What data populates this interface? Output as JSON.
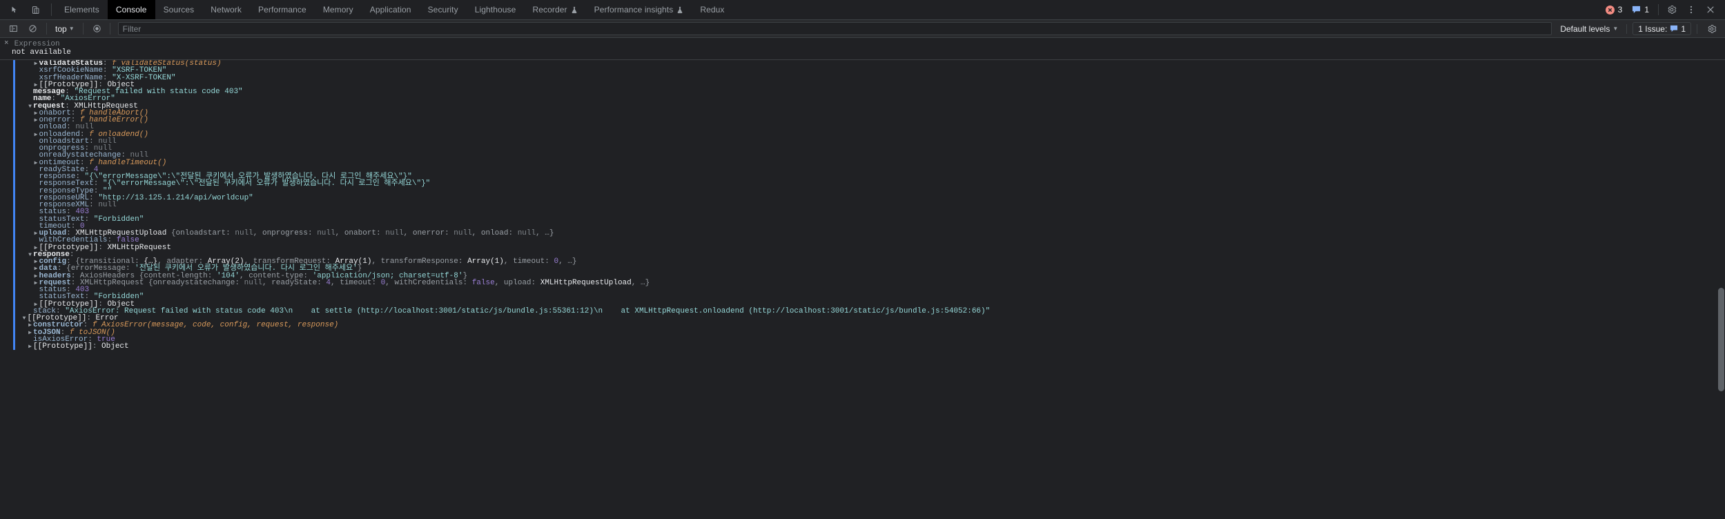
{
  "tabbar": {
    "tool_icons": [
      "inspect-element-icon",
      "device-toolbar-icon"
    ],
    "tabs": [
      {
        "label": "Elements",
        "selected": false,
        "flask": false
      },
      {
        "label": "Console",
        "selected": true,
        "flask": false
      },
      {
        "label": "Sources",
        "selected": false,
        "flask": false
      },
      {
        "label": "Network",
        "selected": false,
        "flask": false
      },
      {
        "label": "Performance",
        "selected": false,
        "flask": false
      },
      {
        "label": "Memory",
        "selected": false,
        "flask": false
      },
      {
        "label": "Application",
        "selected": false,
        "flask": false
      },
      {
        "label": "Security",
        "selected": false,
        "flask": false
      },
      {
        "label": "Lighthouse",
        "selected": false,
        "flask": false
      },
      {
        "label": "Recorder",
        "selected": false,
        "flask": true
      },
      {
        "label": "Performance insights",
        "selected": false,
        "flask": true
      },
      {
        "label": "Redux",
        "selected": false,
        "flask": false
      }
    ],
    "error_count": "3",
    "info_count": "1",
    "settings_label": "gear-icon",
    "more_label": "more-options-icon",
    "close_label": "close-icon"
  },
  "console_toolbar": {
    "sidebar_toggle": "console-sidebar-icon",
    "clear_label": "clear-console-icon",
    "context": "top",
    "eye_label": "live-expression-icon",
    "filter_placeholder": "Filter",
    "filter_value": "",
    "levels": "Default levels",
    "issues_text": "1 Issue:",
    "issues_count": "1",
    "settings_label": "console-settings-icon"
  },
  "expression": {
    "close": "×",
    "label": "Expression",
    "value": "not available"
  },
  "colors": {
    "accent_blue": "#4285f4",
    "error_red": "#f28b82",
    "info_blue": "#8ab4f8",
    "background": "#202124",
    "toolbar_bg": "#292a2d"
  },
  "console_lines": [
    {
      "indent": 3,
      "arrow": "right",
      "segments": [
        {
          "t": "validateStatus",
          "c": "k-own"
        },
        {
          "t": ": ",
          "c": "dim"
        },
        {
          "t": "f ",
          "c": "fnkw"
        },
        {
          "t": "validateStatus(status)",
          "c": "fn"
        }
      ]
    },
    {
      "indent": 3,
      "arrow": "none",
      "segments": [
        {
          "t": "xsrfCookieName",
          "c": "pname"
        },
        {
          "t": ": ",
          "c": "dim"
        },
        {
          "t": "\"XSRF-TOKEN\"",
          "c": "str"
        }
      ]
    },
    {
      "indent": 3,
      "arrow": "none",
      "segments": [
        {
          "t": "xsrfHeaderName",
          "c": "pname"
        },
        {
          "t": ": ",
          "c": "dim"
        },
        {
          "t": "\"X-XSRF-TOKEN\"",
          "c": "str"
        }
      ]
    },
    {
      "indent": 3,
      "arrow": "right",
      "segments": [
        {
          "t": "[[Prototype]]",
          "c": "proto"
        },
        {
          "t": ": ",
          "c": "dim"
        },
        {
          "t": "Object",
          "c": "obj"
        }
      ]
    },
    {
      "indent": 2,
      "arrow": "none",
      "segments": [
        {
          "t": "message",
          "c": "k-own"
        },
        {
          "t": ": ",
          "c": "dim"
        },
        {
          "t": "\"Request failed with status code 403\"",
          "c": "str"
        }
      ]
    },
    {
      "indent": 2,
      "arrow": "none",
      "segments": [
        {
          "t": "name",
          "c": "k-own"
        },
        {
          "t": ": ",
          "c": "dim"
        },
        {
          "t": "\"AxiosError\"",
          "c": "str"
        }
      ]
    },
    {
      "indent": 2,
      "arrow": "down",
      "segments": [
        {
          "t": "request",
          "c": "k-own"
        },
        {
          "t": ": ",
          "c": "dim"
        },
        {
          "t": "XMLHttpRequest",
          "c": "obj"
        }
      ]
    },
    {
      "indent": 3,
      "arrow": "right",
      "segments": [
        {
          "t": "onabort",
          "c": "pname"
        },
        {
          "t": ": ",
          "c": "dim"
        },
        {
          "t": "f ",
          "c": "fnkw"
        },
        {
          "t": "handleAbort()",
          "c": "fn"
        }
      ]
    },
    {
      "indent": 3,
      "arrow": "right",
      "segments": [
        {
          "t": "onerror",
          "c": "pname"
        },
        {
          "t": ": ",
          "c": "dim"
        },
        {
          "t": "f ",
          "c": "fnkw"
        },
        {
          "t": "handleError()",
          "c": "fn"
        }
      ]
    },
    {
      "indent": 3,
      "arrow": "none",
      "segments": [
        {
          "t": "onload",
          "c": "pname"
        },
        {
          "t": ": ",
          "c": "dim"
        },
        {
          "t": "null",
          "c": "nul"
        }
      ]
    },
    {
      "indent": 3,
      "arrow": "right",
      "segments": [
        {
          "t": "onloadend",
          "c": "pname"
        },
        {
          "t": ": ",
          "c": "dim"
        },
        {
          "t": "f ",
          "c": "fnkw"
        },
        {
          "t": "onloadend()",
          "c": "fn"
        }
      ]
    },
    {
      "indent": 3,
      "arrow": "none",
      "segments": [
        {
          "t": "onloadstart",
          "c": "pname"
        },
        {
          "t": ": ",
          "c": "dim"
        },
        {
          "t": "null",
          "c": "nul"
        }
      ]
    },
    {
      "indent": 3,
      "arrow": "none",
      "segments": [
        {
          "t": "onprogress",
          "c": "pname"
        },
        {
          "t": ": ",
          "c": "dim"
        },
        {
          "t": "null",
          "c": "nul"
        }
      ]
    },
    {
      "indent": 3,
      "arrow": "none",
      "segments": [
        {
          "t": "onreadystatechange",
          "c": "pname"
        },
        {
          "t": ": ",
          "c": "dim"
        },
        {
          "t": "null",
          "c": "nul"
        }
      ]
    },
    {
      "indent": 3,
      "arrow": "right",
      "segments": [
        {
          "t": "ontimeout",
          "c": "pname"
        },
        {
          "t": ": ",
          "c": "dim"
        },
        {
          "t": "f ",
          "c": "fnkw"
        },
        {
          "t": "handleTimeout()",
          "c": "fn"
        }
      ]
    },
    {
      "indent": 3,
      "arrow": "none",
      "segments": [
        {
          "t": "readyState",
          "c": "pname"
        },
        {
          "t": ": ",
          "c": "dim"
        },
        {
          "t": "4",
          "c": "num"
        }
      ]
    },
    {
      "indent": 3,
      "arrow": "none",
      "segments": [
        {
          "t": "response",
          "c": "pname"
        },
        {
          "t": ": ",
          "c": "dim"
        },
        {
          "t": "\"{\\\"errorMessage\\\":\\\"전달된 쿠키에서 오류가 발생하였습니다. 다시 로그인 해주세요\\\"}\"",
          "c": "str"
        }
      ]
    },
    {
      "indent": 3,
      "arrow": "none",
      "segments": [
        {
          "t": "responseText",
          "c": "pname"
        },
        {
          "t": ": ",
          "c": "dim"
        },
        {
          "t": "\"{\\\"errorMessage\\\":\\\"전달된 쿠키에서 오류가 발생하였습니다. 다시 로그인 해주세요\\\"}\"",
          "c": "str"
        }
      ]
    },
    {
      "indent": 3,
      "arrow": "none",
      "segments": [
        {
          "t": "responseType",
          "c": "pname"
        },
        {
          "t": ": ",
          "c": "dim"
        },
        {
          "t": "\"\"",
          "c": "str"
        }
      ]
    },
    {
      "indent": 3,
      "arrow": "none",
      "segments": [
        {
          "t": "responseURL",
          "c": "pname"
        },
        {
          "t": ": ",
          "c": "dim"
        },
        {
          "t": "\"http://13.125.1.214/api/worldcup\"",
          "c": "str"
        }
      ]
    },
    {
      "indent": 3,
      "arrow": "none",
      "segments": [
        {
          "t": "responseXML",
          "c": "pname"
        },
        {
          "t": ": ",
          "c": "dim"
        },
        {
          "t": "null",
          "c": "nul"
        }
      ]
    },
    {
      "indent": 3,
      "arrow": "none",
      "segments": [
        {
          "t": "status",
          "c": "pname"
        },
        {
          "t": ": ",
          "c": "dim"
        },
        {
          "t": "403",
          "c": "num"
        }
      ]
    },
    {
      "indent": 3,
      "arrow": "none",
      "segments": [
        {
          "t": "statusText",
          "c": "pname"
        },
        {
          "t": ": ",
          "c": "dim"
        },
        {
          "t": "\"Forbidden\"",
          "c": "str"
        }
      ]
    },
    {
      "indent": 3,
      "arrow": "none",
      "segments": [
        {
          "t": "timeout",
          "c": "pname"
        },
        {
          "t": ": ",
          "c": "dim"
        },
        {
          "t": "0",
          "c": "num"
        }
      ]
    },
    {
      "indent": 3,
      "arrow": "right",
      "segments": [
        {
          "t": "upload",
          "c": "pname-b"
        },
        {
          "t": ": ",
          "c": "dim"
        },
        {
          "t": "XMLHttpRequestUpload ",
          "c": "obj"
        },
        {
          "t": "{",
          "c": "dim"
        },
        {
          "t": "onloadstart",
          "c": "dim"
        },
        {
          "t": ": ",
          "c": "dim"
        },
        {
          "t": "null",
          "c": "nul"
        },
        {
          "t": ", ",
          "c": "dim"
        },
        {
          "t": "onprogress",
          "c": "dim"
        },
        {
          "t": ": ",
          "c": "dim"
        },
        {
          "t": "null",
          "c": "nul"
        },
        {
          "t": ", ",
          "c": "dim"
        },
        {
          "t": "onabort",
          "c": "dim"
        },
        {
          "t": ": ",
          "c": "dim"
        },
        {
          "t": "null",
          "c": "nul"
        },
        {
          "t": ", ",
          "c": "dim"
        },
        {
          "t": "onerror",
          "c": "dim"
        },
        {
          "t": ": ",
          "c": "dim"
        },
        {
          "t": "null",
          "c": "nul"
        },
        {
          "t": ", ",
          "c": "dim"
        },
        {
          "t": "onload",
          "c": "dim"
        },
        {
          "t": ": ",
          "c": "dim"
        },
        {
          "t": "null",
          "c": "nul"
        },
        {
          "t": ", …}",
          "c": "dim"
        }
      ]
    },
    {
      "indent": 3,
      "arrow": "none",
      "segments": [
        {
          "t": "withCredentials",
          "c": "pname"
        },
        {
          "t": ": ",
          "c": "dim"
        },
        {
          "t": "false",
          "c": "bool"
        }
      ]
    },
    {
      "indent": 3,
      "arrow": "right",
      "segments": [
        {
          "t": "[[Prototype]]",
          "c": "proto"
        },
        {
          "t": ": ",
          "c": "dim"
        },
        {
          "t": "XMLHttpRequest",
          "c": "obj"
        }
      ]
    },
    {
      "indent": 2,
      "arrow": "down",
      "segments": [
        {
          "t": "response",
          "c": "k-own"
        },
        {
          "t": ":",
          "c": "dim"
        }
      ]
    },
    {
      "indent": 3,
      "arrow": "right",
      "segments": [
        {
          "t": "config",
          "c": "pname-b"
        },
        {
          "t": ": ",
          "c": "dim"
        },
        {
          "t": "{",
          "c": "dim"
        },
        {
          "t": "transitional",
          "c": "dim"
        },
        {
          "t": ": ",
          "c": "dim"
        },
        {
          "t": "{…}",
          "c": "obj"
        },
        {
          "t": ", ",
          "c": "dim"
        },
        {
          "t": "adapter",
          "c": "dim"
        },
        {
          "t": ": ",
          "c": "dim"
        },
        {
          "t": "Array(2)",
          "c": "obj"
        },
        {
          "t": ", ",
          "c": "dim"
        },
        {
          "t": "transformRequest",
          "c": "dim"
        },
        {
          "t": ": ",
          "c": "dim"
        },
        {
          "t": "Array(1)",
          "c": "obj"
        },
        {
          "t": ", ",
          "c": "dim"
        },
        {
          "t": "transformResponse",
          "c": "dim"
        },
        {
          "t": ": ",
          "c": "dim"
        },
        {
          "t": "Array(1)",
          "c": "obj"
        },
        {
          "t": ", ",
          "c": "dim"
        },
        {
          "t": "timeout",
          "c": "dim"
        },
        {
          "t": ": ",
          "c": "dim"
        },
        {
          "t": "0",
          "c": "num"
        },
        {
          "t": ", …}",
          "c": "dim"
        }
      ]
    },
    {
      "indent": 3,
      "arrow": "right",
      "segments": [
        {
          "t": "data",
          "c": "pname-b"
        },
        {
          "t": ": ",
          "c": "dim"
        },
        {
          "t": "{",
          "c": "dim"
        },
        {
          "t": "errorMessage",
          "c": "dim"
        },
        {
          "t": ": ",
          "c": "dim"
        },
        {
          "t": "'전달된 쿠키에서 오류가 발생하였습니다. 다시 로그인 해주세요'",
          "c": "str"
        },
        {
          "t": "}",
          "c": "dim"
        }
      ]
    },
    {
      "indent": 3,
      "arrow": "right",
      "segments": [
        {
          "t": "headers",
          "c": "pname-b"
        },
        {
          "t": ": ",
          "c": "dim"
        },
        {
          "t": "AxiosHeaders ",
          "c": "dim"
        },
        {
          "t": "{",
          "c": "dim"
        },
        {
          "t": "content-length",
          "c": "dim"
        },
        {
          "t": ": ",
          "c": "dim"
        },
        {
          "t": "'104'",
          "c": "str"
        },
        {
          "t": ", ",
          "c": "dim"
        },
        {
          "t": "content-type",
          "c": "dim"
        },
        {
          "t": ": ",
          "c": "dim"
        },
        {
          "t": "'application/json; charset=utf-8'",
          "c": "str"
        },
        {
          "t": "}",
          "c": "dim"
        }
      ]
    },
    {
      "indent": 3,
      "arrow": "right",
      "segments": [
        {
          "t": "request",
          "c": "pname-b"
        },
        {
          "t": ": ",
          "c": "dim"
        },
        {
          "t": "XMLHttpRequest ",
          "c": "dim"
        },
        {
          "t": "{",
          "c": "dim"
        },
        {
          "t": "onreadystatechange",
          "c": "dim"
        },
        {
          "t": ": ",
          "c": "dim"
        },
        {
          "t": "null",
          "c": "nul"
        },
        {
          "t": ", ",
          "c": "dim"
        },
        {
          "t": "readyState",
          "c": "dim"
        },
        {
          "t": ": ",
          "c": "dim"
        },
        {
          "t": "4",
          "c": "num"
        },
        {
          "t": ", ",
          "c": "dim"
        },
        {
          "t": "timeout",
          "c": "dim"
        },
        {
          "t": ": ",
          "c": "dim"
        },
        {
          "t": "0",
          "c": "num"
        },
        {
          "t": ", ",
          "c": "dim"
        },
        {
          "t": "withCredentials",
          "c": "dim"
        },
        {
          "t": ": ",
          "c": "dim"
        },
        {
          "t": "false",
          "c": "bool"
        },
        {
          "t": ", ",
          "c": "dim"
        },
        {
          "t": "upload",
          "c": "dim"
        },
        {
          "t": ": ",
          "c": "dim"
        },
        {
          "t": "XMLHttpRequestUpload",
          "c": "obj"
        },
        {
          "t": ", …}",
          "c": "dim"
        }
      ]
    },
    {
      "indent": 3,
      "arrow": "none",
      "segments": [
        {
          "t": "status",
          "c": "pname"
        },
        {
          "t": ": ",
          "c": "dim"
        },
        {
          "t": "403",
          "c": "num"
        }
      ]
    },
    {
      "indent": 3,
      "arrow": "none",
      "segments": [
        {
          "t": "statusText",
          "c": "pname"
        },
        {
          "t": ": ",
          "c": "dim"
        },
        {
          "t": "\"Forbidden\"",
          "c": "str"
        }
      ]
    },
    {
      "indent": 3,
      "arrow": "right",
      "segments": [
        {
          "t": "[[Prototype]]",
          "c": "proto"
        },
        {
          "t": ": ",
          "c": "dim"
        },
        {
          "t": "Object",
          "c": "obj"
        }
      ]
    },
    {
      "indent": 2,
      "arrow": "none",
      "segments": [
        {
          "t": "stack",
          "c": "pname"
        },
        {
          "t": ": ",
          "c": "dim"
        },
        {
          "t": "\"AxiosError: Request failed with status code 403\\n    at settle (http://localhost:3001/static/js/bundle.js:55361:12)\\n    at XMLHttpRequest.onloadend (http://localhost:3001/static/js/bundle.js:54052:66)\"",
          "c": "str"
        }
      ]
    },
    {
      "indent": 1,
      "arrow": "down",
      "segments": [
        {
          "t": "[[Prototype]]",
          "c": "proto"
        },
        {
          "t": ": ",
          "c": "dim"
        },
        {
          "t": "Error",
          "c": "obj"
        }
      ]
    },
    {
      "indent": 2,
      "arrow": "right",
      "segments": [
        {
          "t": "constructor",
          "c": "pname-b"
        },
        {
          "t": ": ",
          "c": "dim"
        },
        {
          "t": "f ",
          "c": "fnkw"
        },
        {
          "t": "AxiosError(message, code, config, request, response)",
          "c": "fn"
        }
      ]
    },
    {
      "indent": 2,
      "arrow": "right",
      "segments": [
        {
          "t": "toJSON",
          "c": "pname-b"
        },
        {
          "t": ": ",
          "c": "dim"
        },
        {
          "t": "f ",
          "c": "fnkw"
        },
        {
          "t": "toJSON()",
          "c": "fn"
        }
      ]
    },
    {
      "indent": 2,
      "arrow": "none",
      "segments": [
        {
          "t": "isAxiosError",
          "c": "pname"
        },
        {
          "t": ": ",
          "c": "dim"
        },
        {
          "t": "true",
          "c": "bool"
        }
      ]
    },
    {
      "indent": 2,
      "arrow": "right",
      "segments": [
        {
          "t": "[[Prototype]]",
          "c": "proto"
        },
        {
          "t": ": ",
          "c": "dim"
        },
        {
          "t": "Object",
          "c": "obj"
        }
      ]
    }
  ]
}
